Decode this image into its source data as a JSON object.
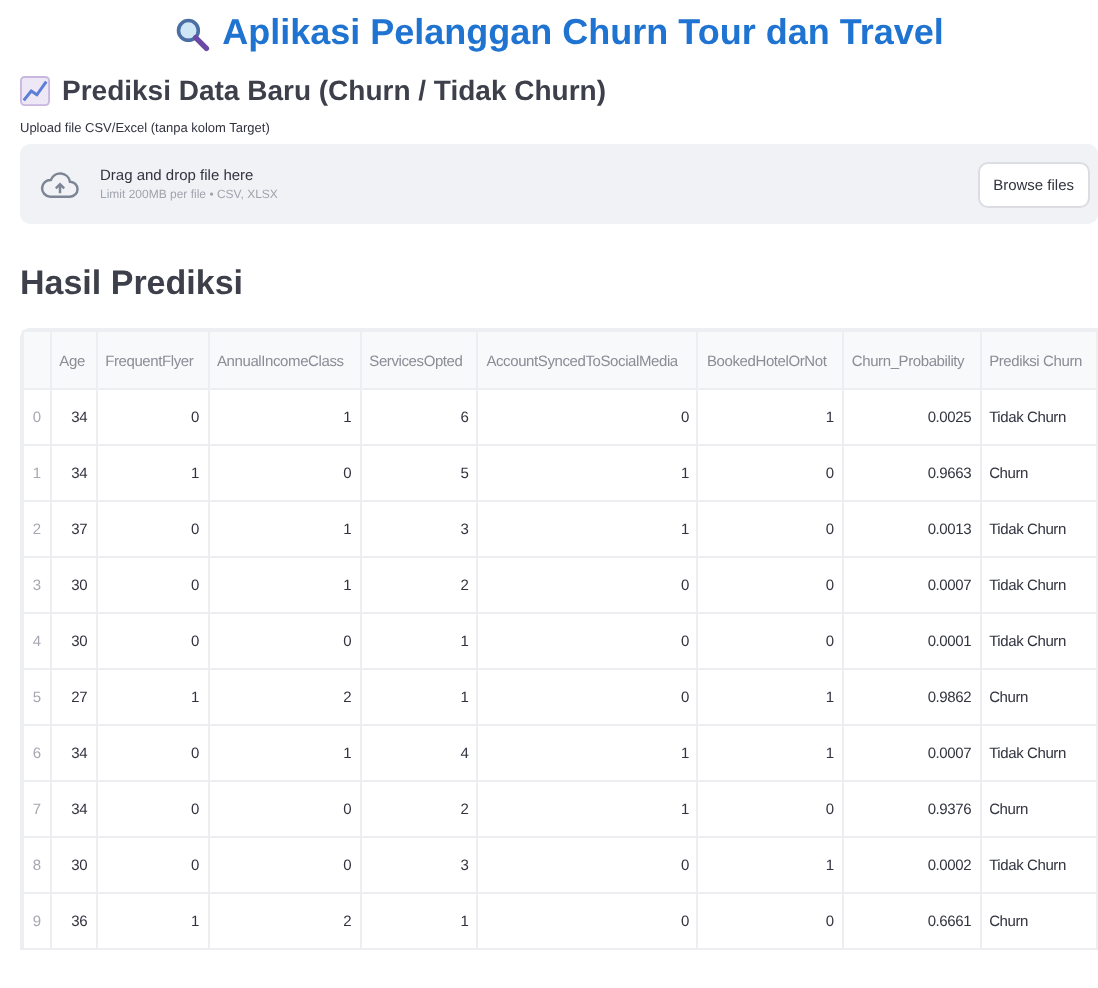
{
  "title": "Aplikasi Pelanggan Churn Tour dan Travel",
  "section": {
    "heading": "Prediksi Data Baru (Churn / Tidak Churn)"
  },
  "uploader": {
    "label": "Upload file CSV/Excel (tanpa kolom Target)",
    "prompt": "Drag and drop file here",
    "limit": "Limit 200MB per file • CSV, XLSX",
    "button": "Browse files"
  },
  "results": {
    "heading": "Hasil Prediksi",
    "table": {
      "columns": [
        "",
        "Age",
        "FrequentFlyer",
        "AnnualIncomeClass",
        "ServicesOpted",
        "AccountSyncedToSocialMedia",
        "BookedHotelOrNot",
        "Churn_Probability",
        "Prediksi Churn"
      ],
      "rows": [
        [
          "0",
          "34",
          "0",
          "1",
          "6",
          "0",
          "1",
          "0.0025",
          "Tidak Churn"
        ],
        [
          "1",
          "34",
          "1",
          "0",
          "5",
          "1",
          "0",
          "0.9663",
          "Churn"
        ],
        [
          "2",
          "37",
          "0",
          "1",
          "3",
          "1",
          "0",
          "0.0013",
          "Tidak Churn"
        ],
        [
          "3",
          "30",
          "0",
          "1",
          "2",
          "0",
          "0",
          "0.0007",
          "Tidak Churn"
        ],
        [
          "4",
          "30",
          "0",
          "0",
          "1",
          "0",
          "0",
          "0.0001",
          "Tidak Churn"
        ],
        [
          "5",
          "27",
          "1",
          "2",
          "1",
          "0",
          "1",
          "0.9862",
          "Churn"
        ],
        [
          "6",
          "34",
          "0",
          "1",
          "4",
          "1",
          "1",
          "0.0007",
          "Tidak Churn"
        ],
        [
          "7",
          "34",
          "0",
          "0",
          "2",
          "1",
          "0",
          "0.9376",
          "Churn"
        ],
        [
          "8",
          "30",
          "0",
          "0",
          "3",
          "0",
          "1",
          "0.0002",
          "Tidak Churn"
        ],
        [
          "9",
          "36",
          "1",
          "2",
          "1",
          "0",
          "0",
          "0.6661",
          "Churn"
        ]
      ]
    }
  }
}
